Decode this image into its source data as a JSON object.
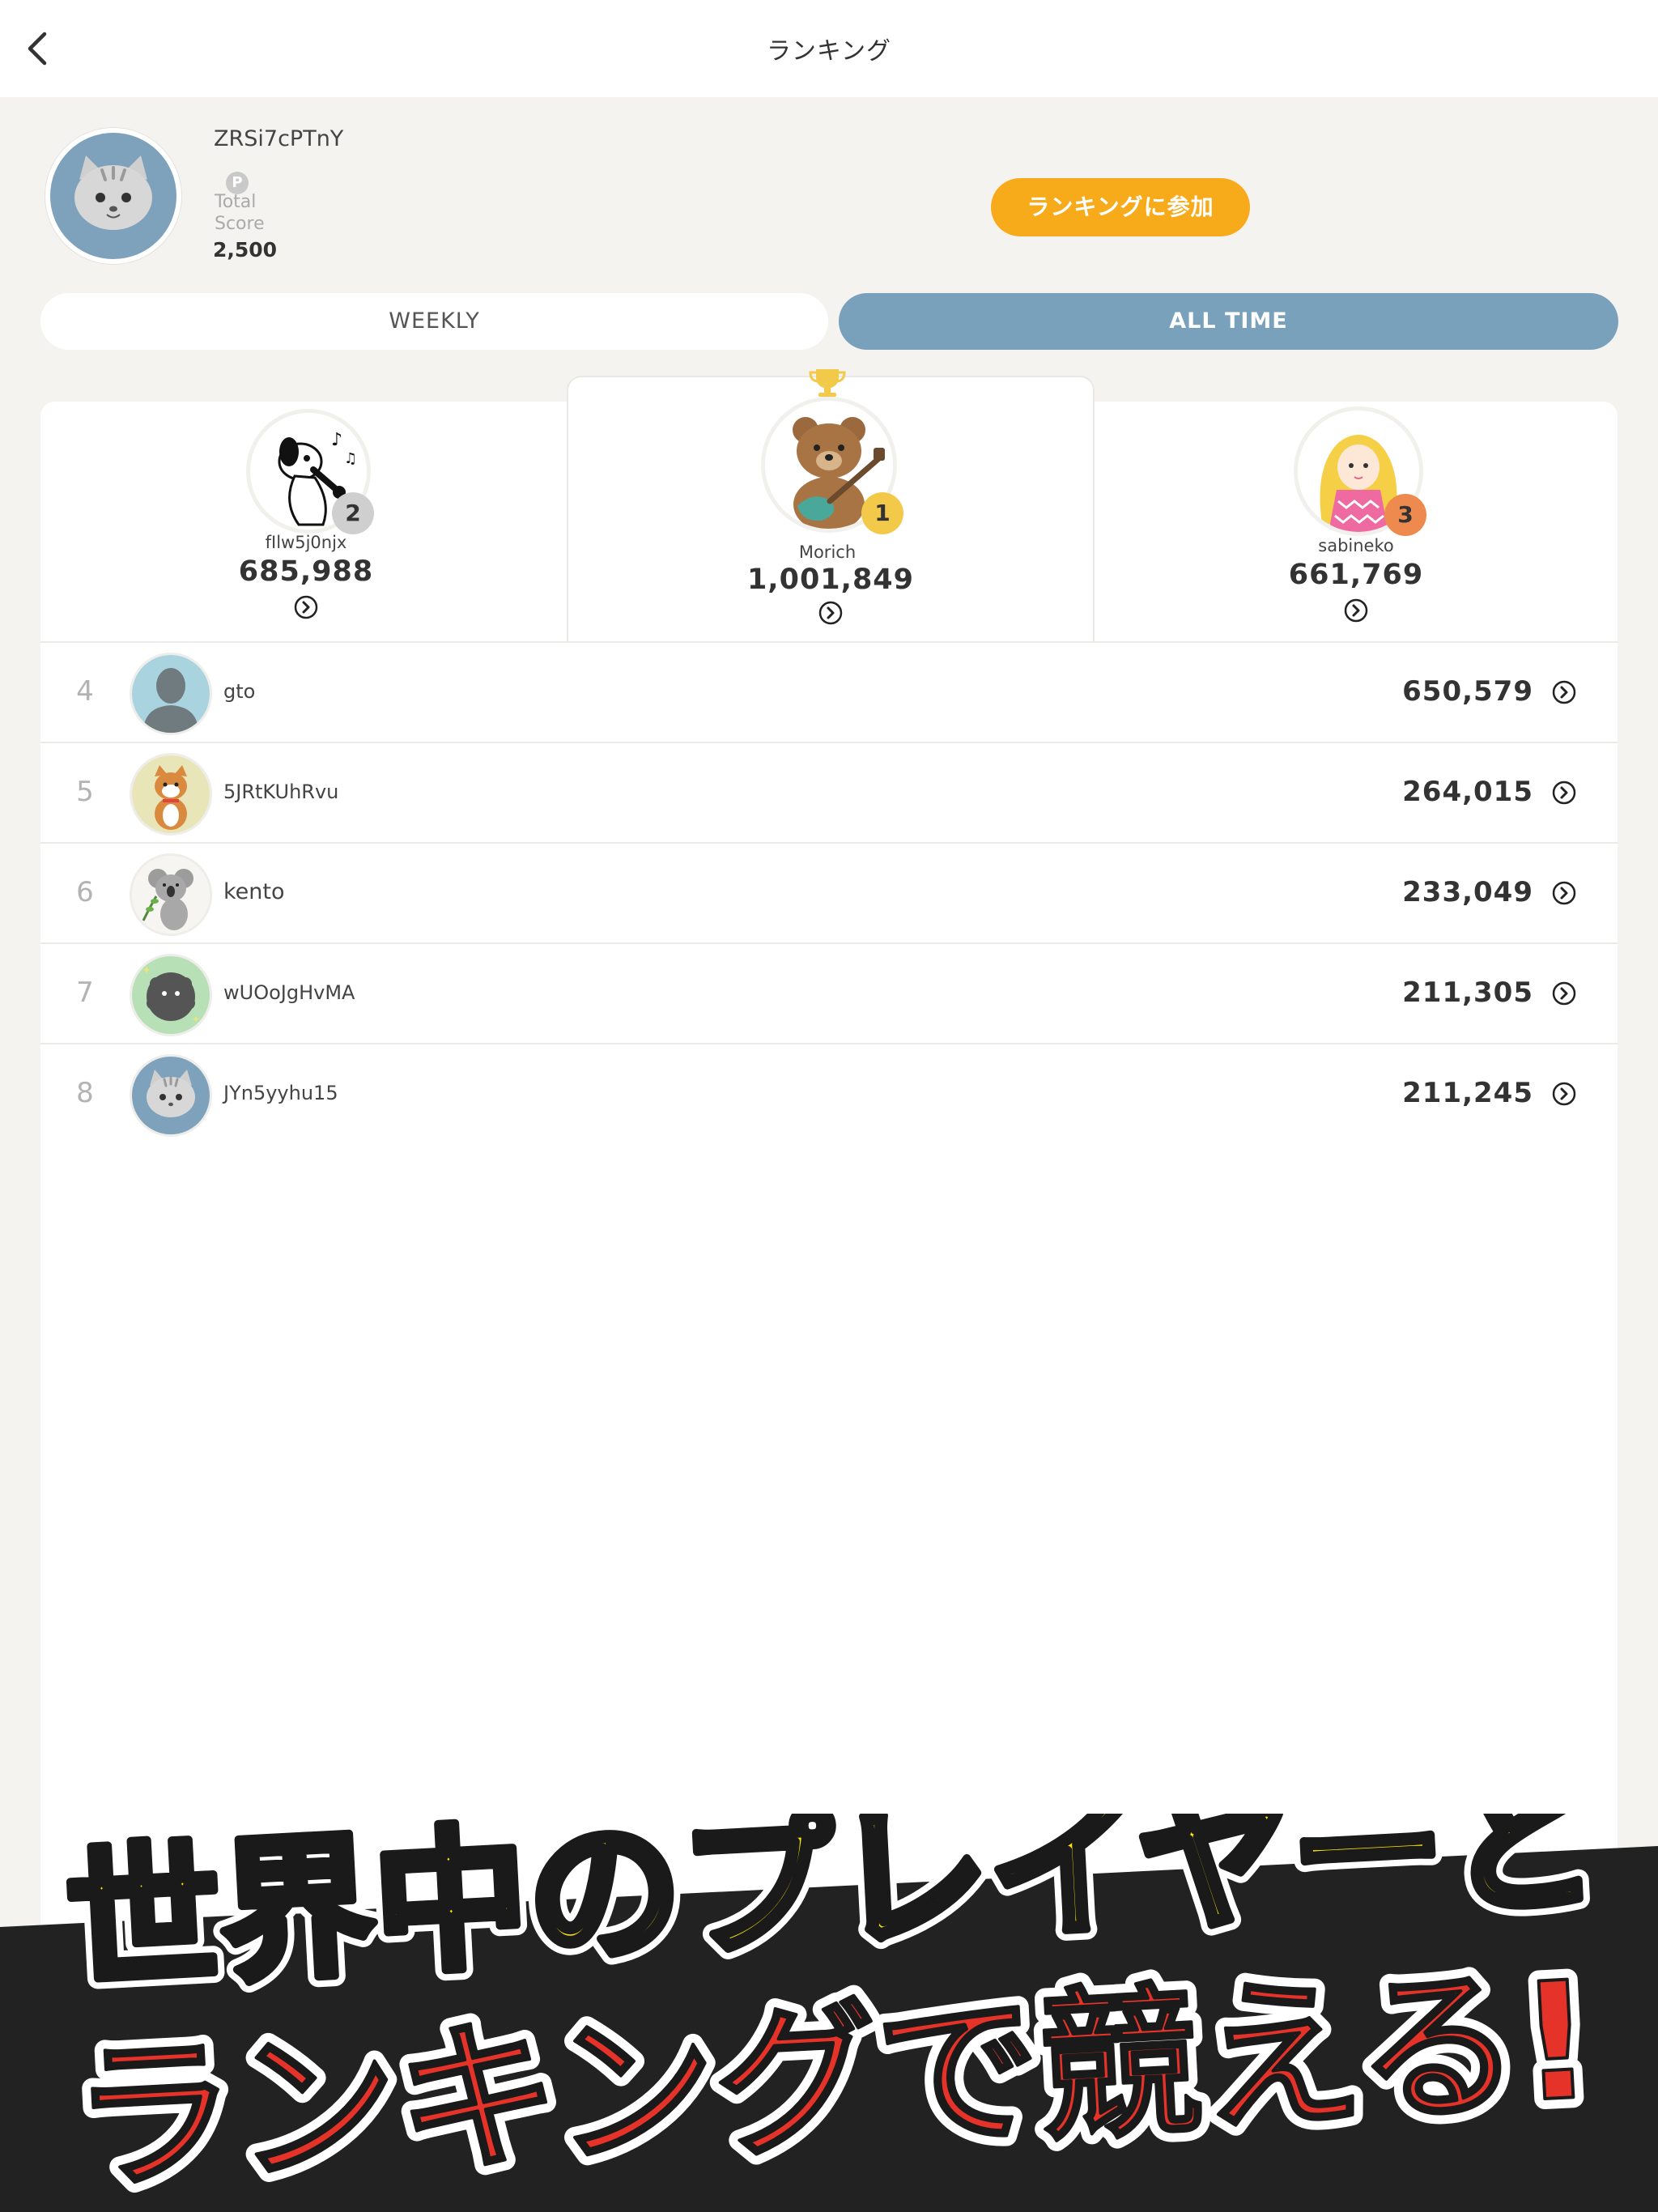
{
  "nav": {
    "title": "ランキング",
    "back_icon": "chevron-left-icon"
  },
  "profile": {
    "username": "ZRSi7cPTnY",
    "points_icon_letter": "P",
    "score_label": "Total Score",
    "score_value": "2,500",
    "join_button": "ランキングに参加"
  },
  "tabs": [
    {
      "label": "WEEKLY",
      "active": false
    },
    {
      "label": "ALL TIME",
      "active": true
    }
  ],
  "podium": [
    {
      "rank": "1",
      "name": "Morich",
      "score": "1,001,849",
      "badge_color": "#f3c94a"
    },
    {
      "rank": "2",
      "name": "fIlw5j0njx",
      "score": "685,988",
      "badge_color": "#cfcfcf"
    },
    {
      "rank": "3",
      "name": "sabineko",
      "score": "661,769",
      "badge_color": "#ef8a4f"
    }
  ],
  "rows": [
    {
      "rank": "4",
      "name": "gto",
      "score": "650,579"
    },
    {
      "rank": "5",
      "name": "5JRtKUhRvu",
      "score": "264,015"
    },
    {
      "rank": "6",
      "name": "kento",
      "score": "233,049"
    },
    {
      "rank": "7",
      "name": "wUOoJgHvMA",
      "score": "211,305"
    },
    {
      "rank": "8",
      "name": "JYn5yyhu15",
      "score": "211,245"
    }
  ],
  "promo": {
    "line1": "世界中のプレイヤーと",
    "line2": "ランキングで競える!",
    "line1_color": "#ffe600",
    "line2_color": "#e5332a"
  },
  "colors": {
    "accent_orange": "#f7aa1a",
    "tab_active": "#7aa1bb",
    "background": "#f4f3ef"
  }
}
